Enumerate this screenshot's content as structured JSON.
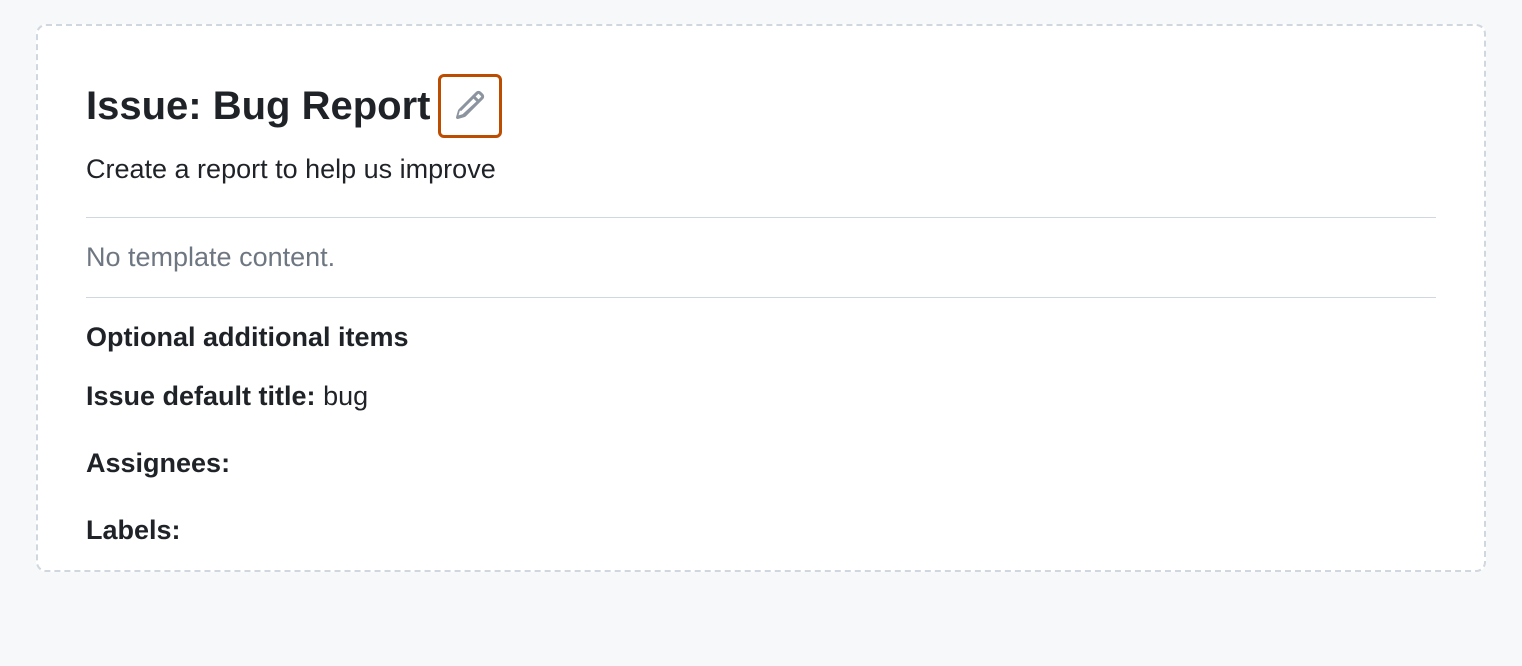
{
  "card": {
    "title": "Issue: Bug Report",
    "subtitle": "Create a report to help us improve",
    "empty_content": "No template content.",
    "section_heading": "Optional additional items",
    "fields": {
      "default_title": {
        "label": "Issue default title:",
        "value": "bug"
      },
      "assignees": {
        "label": "Assignees:",
        "value": ""
      },
      "labels": {
        "label": "Labels:",
        "value": ""
      }
    }
  },
  "colors": {
    "highlight": "#bc4c00",
    "muted": "#6e7781",
    "text": "#1f2328",
    "border": "#d0d7de",
    "bg": "#f6f8fa"
  }
}
